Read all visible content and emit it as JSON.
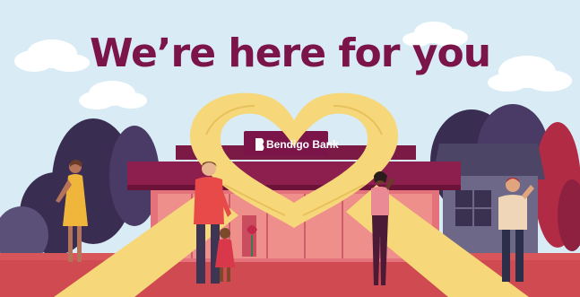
{
  "headline": "We’re here for you",
  "brand": {
    "name": "Bendigo Bank",
    "logo_icon": "bendigo-bell-icon"
  },
  "colors": {
    "brand_burgundy": "#7a1449",
    "sky": "#d7eaf4",
    "hands": "#f6d77a",
    "ground": "#d8565a",
    "trees": "#3b2f52"
  }
}
